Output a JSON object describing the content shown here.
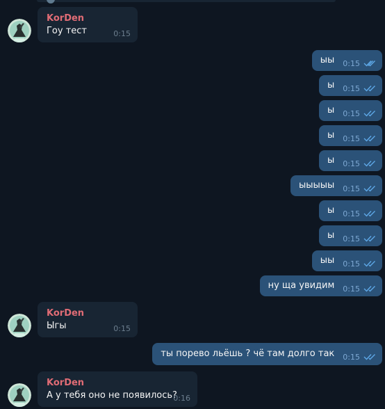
{
  "colors": {
    "background": "#0e1621",
    "incoming_bubble": "#182533",
    "outgoing_bubble": "#2b5278",
    "sender_name": "#e06c75",
    "read_check": "#5ea9e8"
  },
  "messages": [
    {
      "direction": "in",
      "sender": "KorDen",
      "text": "Гоу тест",
      "time": "0:15"
    },
    {
      "direction": "out",
      "text": "ыы",
      "time": "0:15",
      "status_icon": "double-check-icon"
    },
    {
      "direction": "out",
      "text": "ы",
      "time": "0:15",
      "status_icon": "double-check-icon"
    },
    {
      "direction": "out",
      "text": "ы",
      "time": "0:15",
      "status_icon": "double-check-icon"
    },
    {
      "direction": "out",
      "text": "ы",
      "time": "0:15",
      "status_icon": "double-check-icon"
    },
    {
      "direction": "out",
      "text": "ы",
      "time": "0:15",
      "status_icon": "double-check-icon"
    },
    {
      "direction": "out",
      "text": "ыыыыы",
      "time": "0:15",
      "status_icon": "double-check-icon"
    },
    {
      "direction": "out",
      "text": "ы",
      "time": "0:15",
      "status_icon": "double-check-icon"
    },
    {
      "direction": "out",
      "text": "ы",
      "time": "0:15",
      "status_icon": "double-check-icon"
    },
    {
      "direction": "out",
      "text": "ыы",
      "time": "0:15",
      "status_icon": "double-check-icon"
    },
    {
      "direction": "out",
      "text": "ну ща увидим",
      "time": "0:15",
      "status_icon": "double-check-icon"
    },
    {
      "direction": "in",
      "sender": "KorDen",
      "text": "Ыгы",
      "time": "0:15"
    },
    {
      "direction": "out",
      "text": "ты порево льёшь ? чё там долго так",
      "time": "0:15",
      "status_icon": "double-check-icon"
    },
    {
      "direction": "in",
      "sender": "KorDen",
      "text": "А у тебя оно не появилось?",
      "time": "0:16"
    }
  ]
}
